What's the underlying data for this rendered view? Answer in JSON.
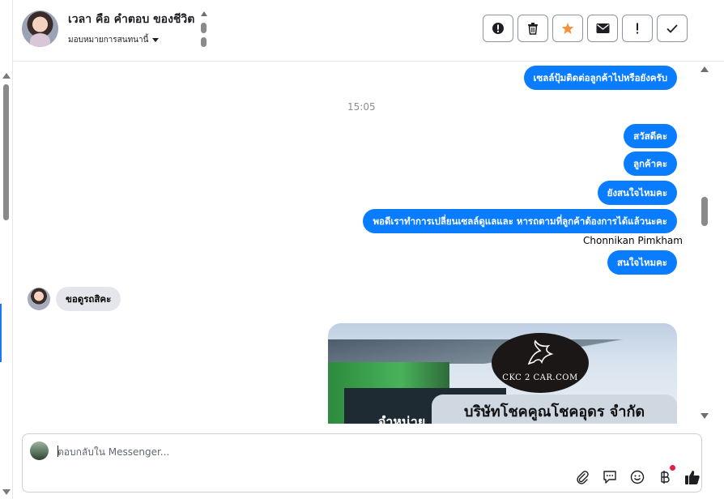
{
  "header": {
    "contact_name": "เวลา คือ คําตอบ ของชีวิต",
    "assign_label": "มอบหมายการสนทนานี้",
    "toolbar": {
      "buttons": [
        {
          "name": "report-button",
          "icon": "alert-circle-icon"
        },
        {
          "name": "delete-button",
          "icon": "trash-icon"
        },
        {
          "name": "star-button",
          "icon": "star-icon",
          "color": "#f7923b"
        },
        {
          "name": "mark-unread-button",
          "icon": "envelope-icon"
        },
        {
          "name": "flag-important-button",
          "icon": "exclamation-icon"
        },
        {
          "name": "mark-done-button",
          "icon": "check-icon"
        }
      ]
    }
  },
  "colors": {
    "outgoing_bubble": "#0a7cff",
    "incoming_bubble": "#e4e6eb",
    "star": "#f7923b"
  },
  "messages": {
    "outgoing_1": "เซลล์ปุ้มติดต่อลูกค้าไปหรือยังครับ",
    "timestamp": "15:05",
    "outgoing_2": "สวัสดีคะ",
    "outgoing_3": "ลูกค้าคะ",
    "outgoing_4": "ยังสนใจไหมคะ",
    "outgoing_5": "พอดีเราทําการเปลี่ยนเซลล์ดูแลและ หารถตามที่ลูกค้าต้องการได้แล้วนะคะ",
    "sender_name": "Chonnikan Pimkham",
    "outgoing_6": "สนใจไหมคะ",
    "incoming_1": "ขอดูรถสิคะ",
    "image": {
      "logo_text": "CKC 2 CAR.COM",
      "banner_text": "บริษัทโชคคูณโชคอุดร จํากัด",
      "shop_text": "จําหน่าย"
    }
  },
  "composer": {
    "placeholder": "ตอบกลับใน Messenger...",
    "icons": [
      "paperclip-icon",
      "saved-replies-icon",
      "emoji-icon",
      "baht-payment-icon",
      "like-icon"
    ]
  }
}
